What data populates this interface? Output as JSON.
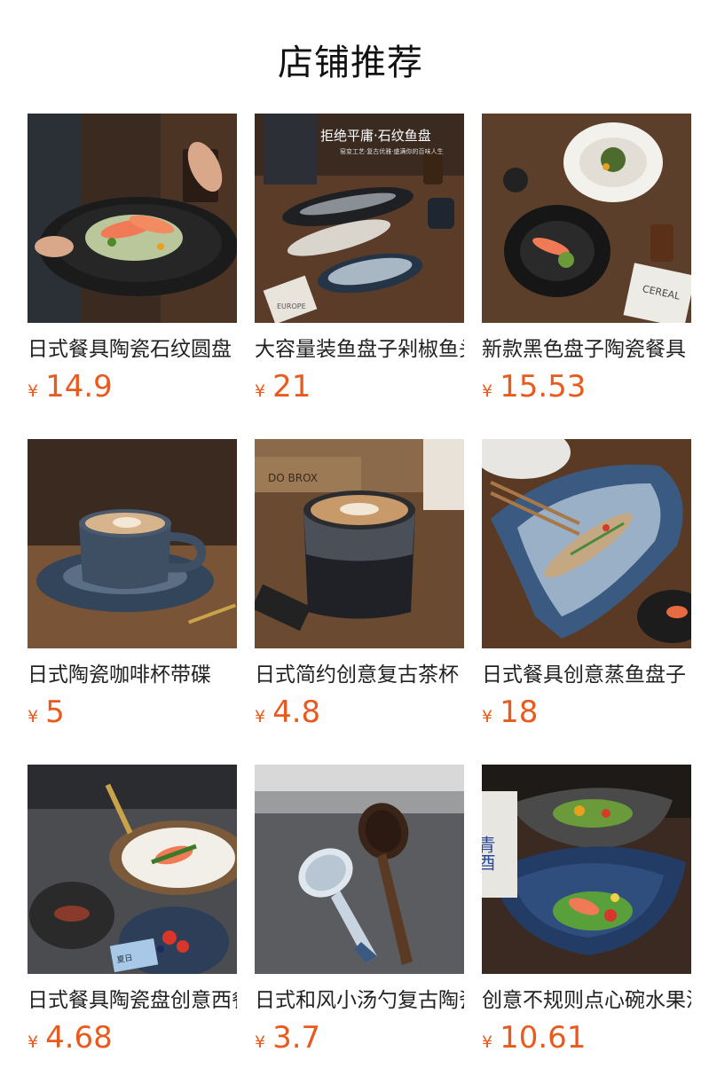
{
  "page": {
    "title": "店铺推荐"
  },
  "colors": {
    "price": "#e85a1d",
    "text": "#222222",
    "background": "#ffffff"
  },
  "products": [
    {
      "name": "日式餐具陶瓷石纹圆盘",
      "currency": "¥",
      "price": "14.9",
      "image": "black stone-texture plate with salmon salad"
    },
    {
      "name": "大容量装鱼盘子剁椒鱼头盘",
      "currency": "¥",
      "price": "21",
      "image": "oval fish plates",
      "banner_title": "拒绝平庸·石纹鱼盘",
      "banner_sub": "窑变工艺·复古优雅·盛满你的百味人生"
    },
    {
      "name": "新款黑色盘子陶瓷餐具",
      "currency": "¥",
      "price": "15.53",
      "image": "black plate and white bowl",
      "magazine_text": "CEREAL"
    },
    {
      "name": "日式陶瓷咖啡杯带碟",
      "currency": "¥",
      "price": "5",
      "image": "blue glazed coffee cup with saucer"
    },
    {
      "name": "日式简约创意复古茶杯",
      "currency": "¥",
      "price": "4.8",
      "image": "black speckled latte cup",
      "crate_text": "DO BROX"
    },
    {
      "name": "日式餐具创意蒸鱼盘子",
      "currency": "¥",
      "price": "18",
      "image": "blue fish-shaped plate with steamed fish"
    },
    {
      "name": "日式餐具陶瓷盘创意西餐盘",
      "currency": "¥",
      "price": "4.68",
      "image": "striped plates with salmon and steak",
      "card_text": "夏日"
    },
    {
      "name": "日式和风小汤勺复古陶瓷勺",
      "currency": "¥",
      "price": "3.7",
      "image": "two ceramic spoons"
    },
    {
      "name": "创意不规则点心碗水果沙拉碗",
      "currency": "¥",
      "price": "10.61",
      "image": "irregular blue bowls with salad",
      "bottle_text": "青酉"
    }
  ]
}
